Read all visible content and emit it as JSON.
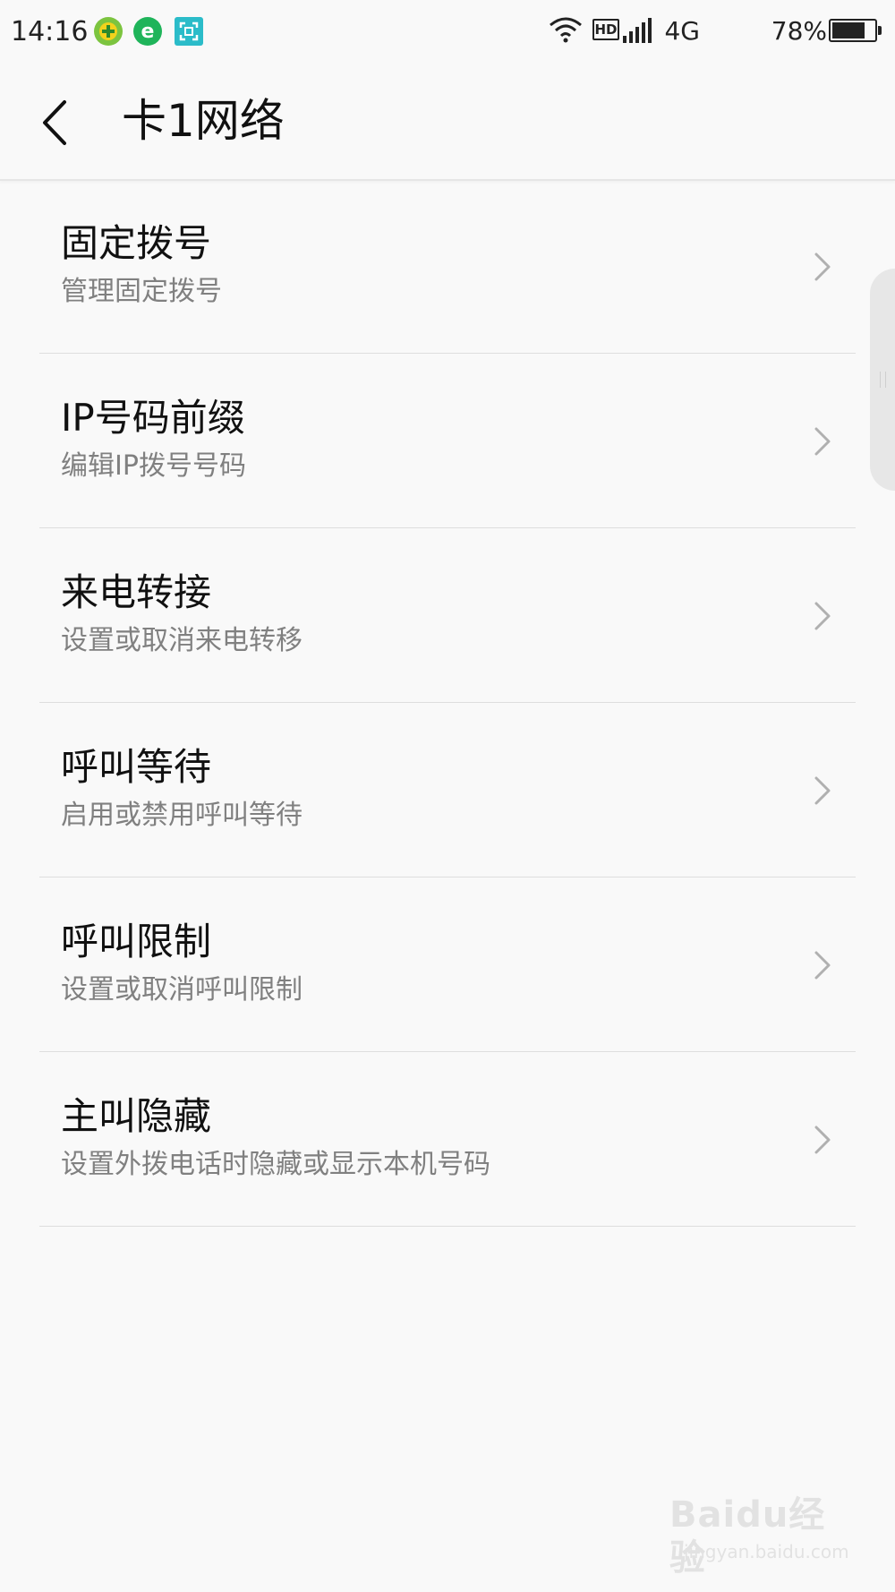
{
  "status_bar": {
    "time": "14:16",
    "notification_icons": [
      "add-icon",
      "browser-e-icon",
      "scanner-icon"
    ],
    "hd_label": "HD",
    "network_label": "4G",
    "battery_percent": "78%",
    "battery_level": 0.78
  },
  "header": {
    "title": "卡1网络"
  },
  "list": {
    "items": [
      {
        "title": "固定拨号",
        "subtitle": "管理固定拨号"
      },
      {
        "title": "IP号码前缀",
        "subtitle": "编辑IP拨号号码"
      },
      {
        "title": "来电转接",
        "subtitle": "设置或取消来电转移"
      },
      {
        "title": "呼叫等待",
        "subtitle": "启用或禁用呼叫等待"
      },
      {
        "title": "呼叫限制",
        "subtitle": "设置或取消呼叫限制"
      },
      {
        "title": "主叫隐藏",
        "subtitle": "设置外拨电话时隐藏或显示本机号码"
      }
    ]
  },
  "watermark": {
    "logo_text": "Baidu经验",
    "url": "jingyan.baidu.com"
  },
  "colors": {
    "background": "#f9f9f9",
    "title_text": "#111111",
    "subtitle_text": "#808080",
    "divider": "#dedede",
    "notif_green": "#5cc43f",
    "notif_e_green": "#1fb45a",
    "notif_teal": "#2bbcc9"
  }
}
